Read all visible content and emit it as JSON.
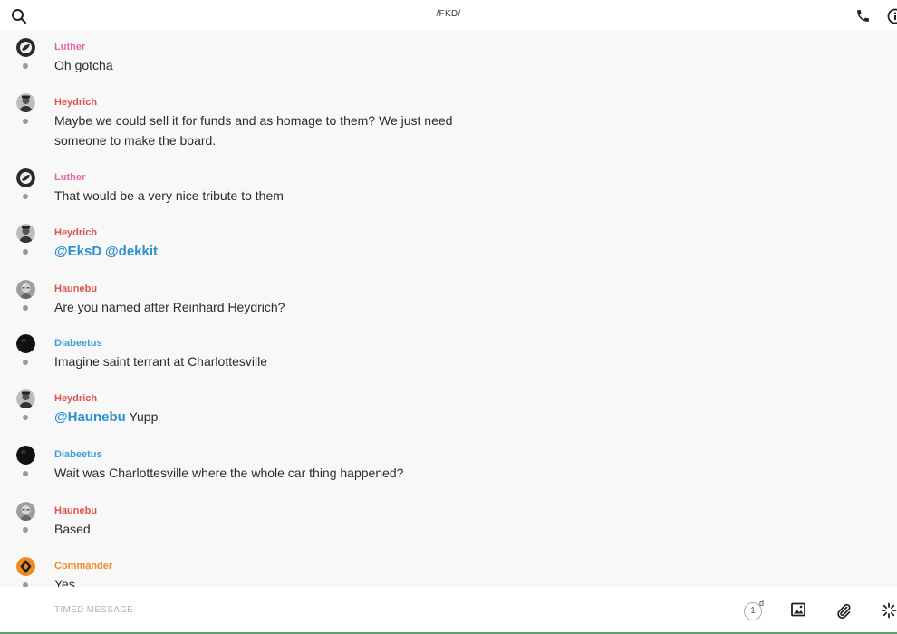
{
  "header": {
    "title": "/FKD/"
  },
  "colors": {
    "author_pink": "#e36aa5",
    "author_red": "#d9534f",
    "author_blue": "#3aa0d0",
    "author_orange": "#f08a24",
    "mention": "#2f8fcf"
  },
  "messages": [
    {
      "author": "Luther",
      "text": "Oh gotcha"
    },
    {
      "author": "Heydrich",
      "text": "Maybe we could sell it for funds and as homage to them? We just need someone to make the board."
    },
    {
      "author": "Luther",
      "text": "That would be a very nice tribute to them"
    },
    {
      "author": "Heydrich",
      "mention1": "@EksD",
      "mention2": "@dekkit"
    },
    {
      "author": "Haunebu",
      "text": "Are you named after Reinhard Heydrich?"
    },
    {
      "author": "Diabeetus",
      "text": "Imagine saint terrant at Charlottesville"
    },
    {
      "author": "Heydrich",
      "mention": "@Haunebu",
      "text": "Yupp"
    },
    {
      "author": "Diabeetus",
      "text": "Wait was Charlottesville where the whole car thing happened?"
    },
    {
      "author": "Haunebu",
      "text": "Based"
    },
    {
      "author": "Commander",
      "text": "Yes"
    }
  ],
  "composer": {
    "placeholder": "TIMED MESSAGE",
    "timer_value": "1",
    "timer_unit": "d"
  }
}
